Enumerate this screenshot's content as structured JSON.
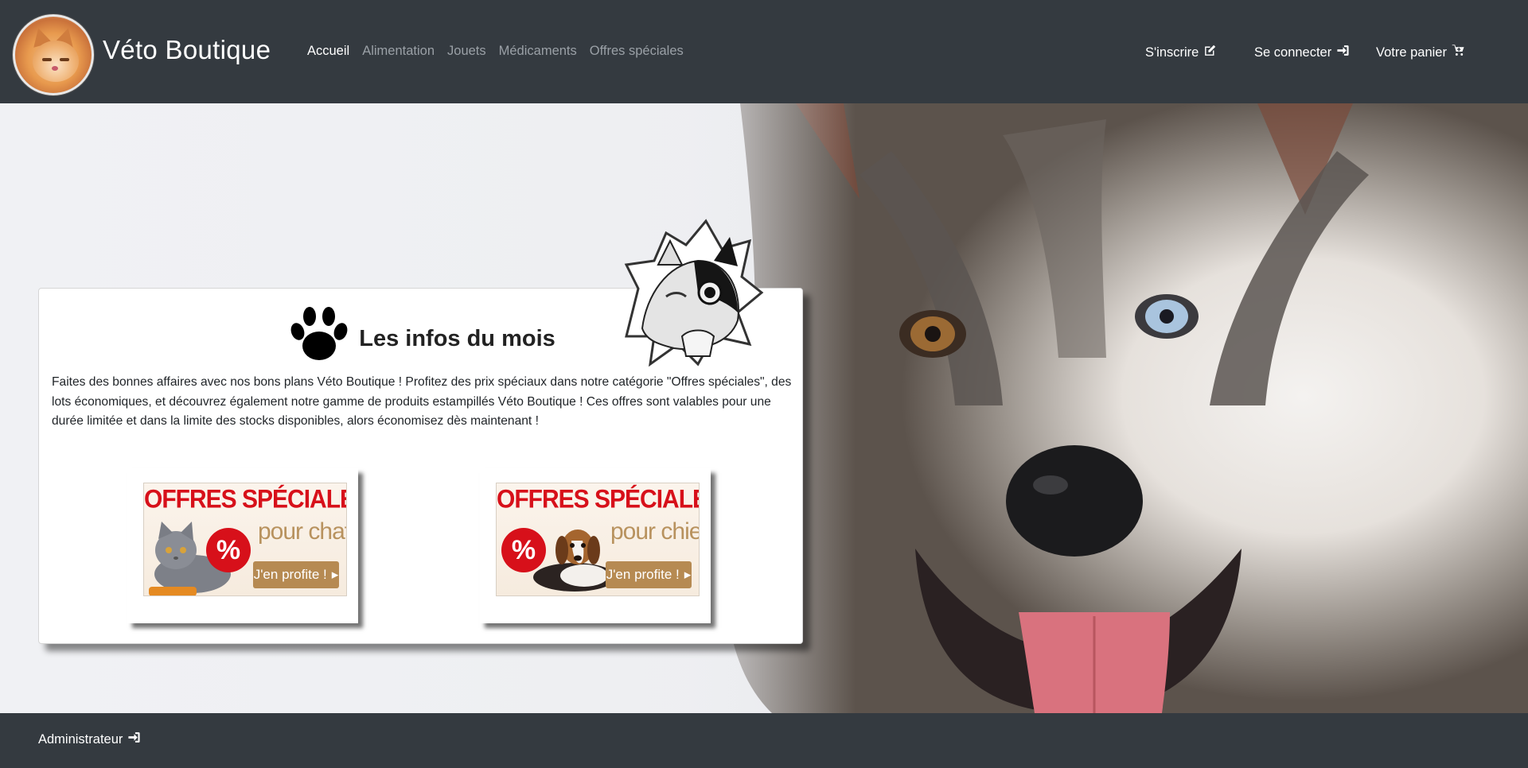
{
  "brand": {
    "title": "Véto Boutique"
  },
  "nav": {
    "links": [
      {
        "label": "Accueil",
        "active": true
      },
      {
        "label": "Alimentation",
        "active": false
      },
      {
        "label": "Jouets",
        "active": false
      },
      {
        "label": "Médicaments",
        "active": false
      },
      {
        "label": "Offres spéciales",
        "active": false
      }
    ],
    "signup_label": "S'inscrire",
    "login_label": "Se connecter",
    "cart_label": "Votre panier"
  },
  "card": {
    "title": "Les infos du mois",
    "text": "Faites des bonnes affaires avec nos bons plans Véto Boutique ! Profitez des prix spéciaux dans notre catégorie \"Offres spéciales\", des lots économiques, et découvrez également notre gamme de produits estampillés Véto Boutique ! Ces offres sont valables pour une durée limitée et dans la limite des stocks disponibles, alors économisez dès maintenant !"
  },
  "promos": [
    {
      "title": "OFFRES SPÉCIALES",
      "subtitle": "pour chat",
      "badge": "%",
      "cta": "J'en profite !"
    },
    {
      "title": "OFFRES SPÉCIALES",
      "subtitle": "pour chien",
      "badge": "%",
      "cta": "J'en profite !"
    }
  ],
  "footer": {
    "admin_label": "Administrateur"
  },
  "icons": {
    "signup": "edit-icon",
    "login": "sign-in-icon",
    "cart": "cart-icon",
    "admin": "sign-in-icon",
    "title": "paw-icon"
  },
  "colors": {
    "navbar": "#343a40",
    "nav_link_inactive": "#9aa0a6",
    "nav_link_active": "#ffffff",
    "promo_red": "#d7101a",
    "promo_gold": "#b68a52"
  }
}
